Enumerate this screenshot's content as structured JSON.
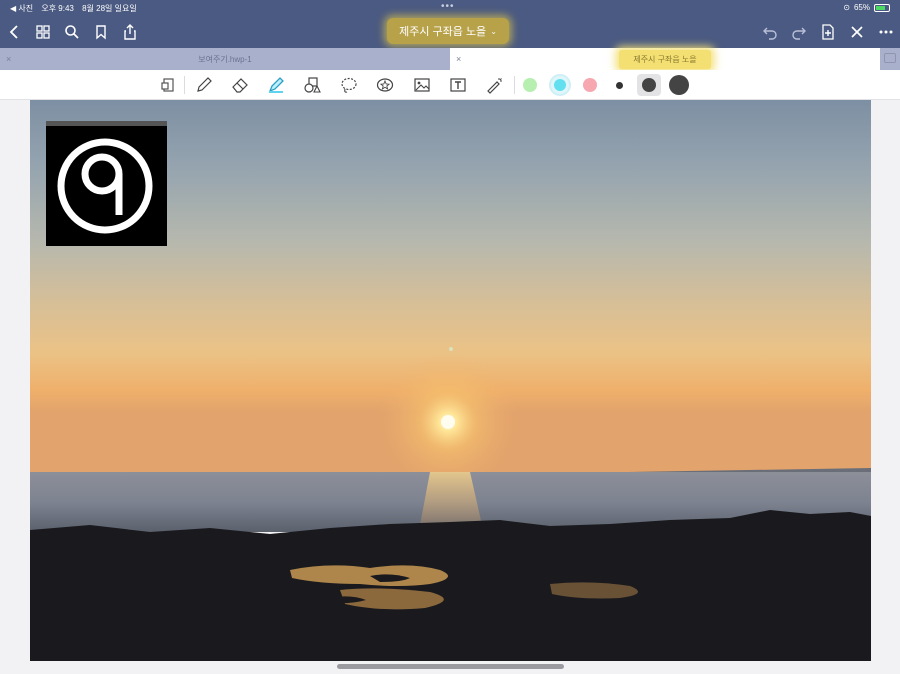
{
  "status_bar": {
    "back_app": "◀ 사진",
    "time": "오후 9:43",
    "date": "8월 28일 일요일",
    "battery": "65%"
  },
  "header": {
    "document_title": "제주시 구좌읍 노을"
  },
  "tabs": [
    {
      "label": "보여주기.hwp-1",
      "active": false
    },
    {
      "label": "제주시 구좌읍 노을",
      "active": true
    }
  ],
  "toolbar": {
    "tools": [
      "page-icon",
      "pen-icon",
      "eraser-icon",
      "highlighter-icon",
      "shapes-icon",
      "lasso-icon",
      "sticker-icon",
      "image-icon",
      "text-box-icon",
      "laser-pointer-icon"
    ],
    "colors": [
      "#b6efb0",
      "#62e0ef",
      "#f6a7b0"
    ],
    "stroke_sizes": [
      "small",
      "medium",
      "large"
    ]
  },
  "logo": {
    "icon": "circled-nine-logo"
  }
}
